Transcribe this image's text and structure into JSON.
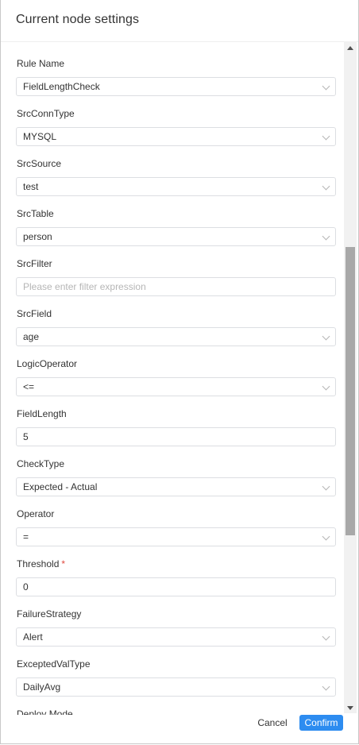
{
  "header": {
    "title": "Current node settings"
  },
  "form": {
    "fields": [
      {
        "label": "Rule Name",
        "value": "FieldLengthCheck",
        "type": "select"
      },
      {
        "label": "SrcConnType",
        "value": "MYSQL",
        "type": "select"
      },
      {
        "label": "SrcSource",
        "value": "test",
        "type": "select"
      },
      {
        "label": "SrcTable",
        "value": "person",
        "type": "select"
      },
      {
        "label": "SrcFilter",
        "value": "",
        "placeholder": "Please enter filter expression",
        "type": "input"
      },
      {
        "label": "SrcField",
        "value": "age",
        "type": "select"
      },
      {
        "label": "LogicOperator",
        "value": "<=",
        "type": "select"
      },
      {
        "label": "FieldLength",
        "value": "5",
        "type": "input"
      },
      {
        "label": "CheckType",
        "value": "Expected - Actual",
        "type": "select"
      },
      {
        "label": "Operator",
        "value": "=",
        "type": "select"
      },
      {
        "label": "Threshold",
        "required_mark": "*",
        "value": "0",
        "type": "input"
      },
      {
        "label": "FailureStrategy",
        "value": "Alert",
        "type": "select"
      },
      {
        "label": "ExceptedValType",
        "value": "DailyAvg",
        "type": "select"
      },
      {
        "label": "Deploy Mode"
      }
    ]
  },
  "footer": {
    "cancel_label": "Cancel",
    "confirm_label": "Confirm"
  },
  "colors": {
    "primary": "#2d8cf0",
    "required": "#e04a3f",
    "border": "#dcdee2"
  }
}
